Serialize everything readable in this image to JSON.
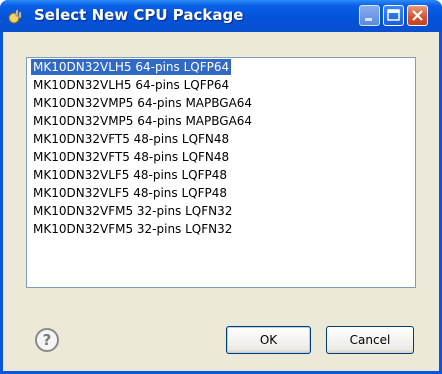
{
  "window": {
    "title": "Select New CPU Package",
    "app_icon": "eclipse-plug-icon"
  },
  "packages": [
    "MK10DN32VLH5 64-pins LQFP64",
    "MK10DN32VLH5 64-pins LQFP64",
    "MK10DN32VMP5 64-pins MAPBGA64",
    "MK10DN32VMP5 64-pins MAPBGA64",
    "MK10DN32VFT5 48-pins LQFN48",
    "MK10DN32VFT5 48-pins LQFN48",
    "MK10DN32VLF5 48-pins LQFP48",
    "MK10DN32VLF5 48-pins LQFP48",
    "MK10DN32VFM5 32-pins LQFN32",
    "MK10DN32VFM5 32-pins LQFN32"
  ],
  "selected_index": 0,
  "buttons": {
    "ok": "OK",
    "cancel": "Cancel",
    "help": "?"
  },
  "colors": {
    "titlebar": "#0453d8",
    "selection": "#316ac5",
    "dialog_bg": "#ece9d8"
  }
}
